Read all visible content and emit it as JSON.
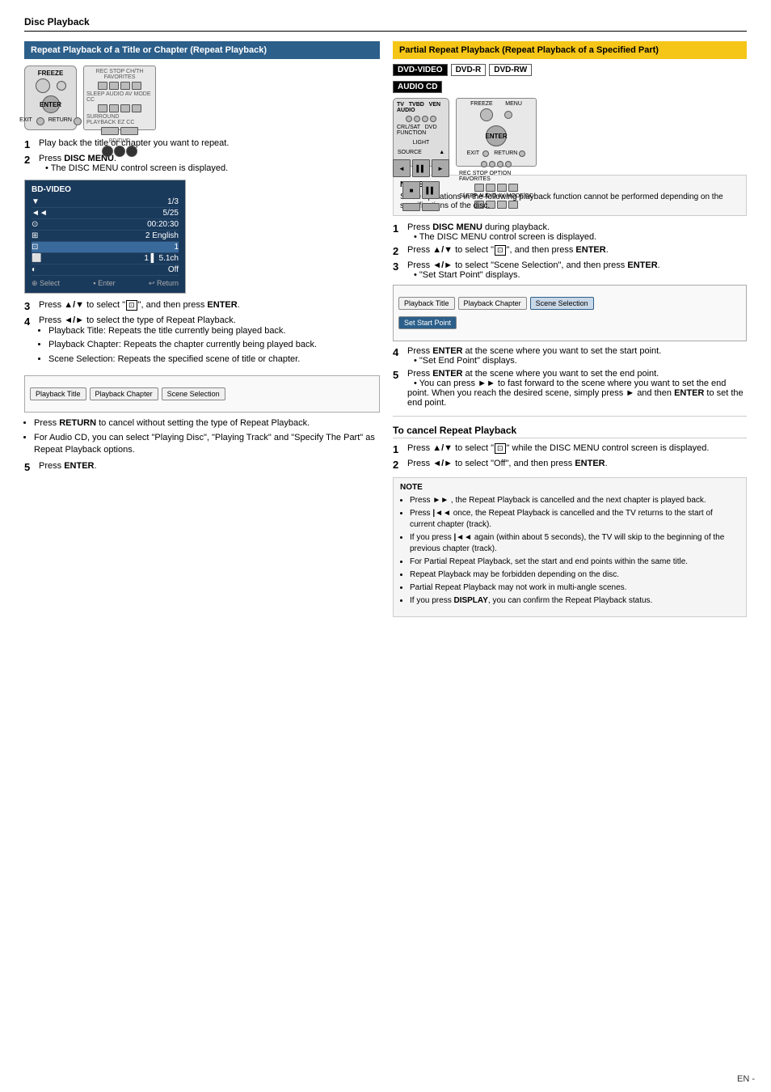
{
  "page": {
    "title": "Disc Playback"
  },
  "left_section": {
    "header": "Repeat Playback of a Title or Chapter (Repeat Playback)",
    "steps": [
      {
        "num": "1",
        "text": "Play back the title or chapter you want to repeat."
      },
      {
        "num": "2",
        "text_prefix": "Press ",
        "bold": "DISC MENU",
        "text_suffix": ".",
        "sub": "• The DISC MENU control screen is displayed."
      },
      {
        "num": "3",
        "text_prefix": "Press ",
        "arrow": "▲/▼",
        "text_mid": " to select “",
        "icon_text": "⊡",
        "text_suffix": "”, and then press ",
        "bold2": "ENTER",
        "end": "."
      },
      {
        "num": "4",
        "text_prefix": "Press ",
        "arrow2": "◄/►",
        "text_mid": " to select the type of Repeat Playback.",
        "bullets": [
          "Playback Title: Repeats the title currently being played back.",
          "Playback Chapter: Repeats the chapter currently being played back.",
          "Scene Selection: Repeats the specified scene of title or chapter."
        ]
      },
      {
        "num": "5",
        "text_prefix": "Press ",
        "bold": "ENTER",
        "end": "."
      }
    ],
    "extra_bullets": [
      "Press RETURN to cancel without setting the type of Repeat Playback.",
      "For Audio CD, you can select \"Playing Disc\", \"Playing Track\" and \"Specify The Part\" as Repeat Playback options."
    ],
    "screen_data": {
      "header": "BD-VIDEO",
      "rows": [
        {
          "label": "▼",
          "value": "1/3"
        },
        {
          "label": "◄◄",
          "value": "5/25"
        },
        {
          "label": "⊙",
          "value": "00:20:30"
        },
        {
          "label": "⊞",
          "value": "2 English"
        },
        {
          "label": "⊡",
          "value": "1"
        },
        {
          "label": "⬜",
          "value": "1  ▐▐  5.1ch"
        },
        {
          "label": "◐",
          "value": "Off"
        }
      ],
      "footer_left": "⊕ Select",
      "footer_mid": "ENTER Enter",
      "footer_right": "RETURN Return"
    },
    "options_bar": [
      {
        "label": "Playback Title",
        "type": "normal"
      },
      {
        "label": "Playback Chapter",
        "type": "normal"
      },
      {
        "label": "Scene Selection",
        "type": "normal"
      }
    ]
  },
  "right_section": {
    "header": "Partial Repeat Playback (Repeat Playback of a Specified Part)",
    "formats": [
      "DVD-VIDEO",
      "DVD-R",
      "DVD-RW",
      "AUDIO CD"
    ],
    "note": {
      "header": "NOTE",
      "text": "Some operations in the following playback function cannot be performed depending on the specifications of the disc."
    },
    "steps": [
      {
        "num": "1",
        "text_prefix": "Press ",
        "bold": "DISC MENU",
        "text_suffix": " during playback.",
        "sub": "• The DISC MENU control screen is displayed."
      },
      {
        "num": "2",
        "text_prefix": "Press ",
        "arrow": "▲/▼",
        "text_mid": " to select “",
        "icon_text": "⊡",
        "text_suffix": "”, and then press ",
        "bold2": "ENTER",
        "end": "."
      },
      {
        "num": "3",
        "text_prefix": "Press ",
        "arrow2": "◄/►",
        "text_mid": " to select “Scene Selection”, and then press ",
        "bold2": "ENTER",
        "end": ".",
        "sub": "• \"Set Start Point\" displays."
      },
      {
        "num": "4",
        "text_prefix": "Press ",
        "bold": "ENTER",
        "text_suffix": " at the scene where you want to set the start point.",
        "sub": "• \"Set End Point\" displays."
      },
      {
        "num": "5",
        "text_prefix": "Press ",
        "bold": "ENTER",
        "text_suffix": " at the scene where you want to set the end point.",
        "sub": "• You can press ►► to fast forward to the scene where you want to set the end point. When you reach the desired scene, simply press ► and then ENTER to set the end point."
      }
    ],
    "options_bar_right": [
      {
        "label": "Playback Title",
        "type": "normal"
      },
      {
        "label": "Playback Chapter",
        "type": "normal"
      },
      {
        "label": "Scene Selection",
        "type": "highlighted"
      },
      {
        "label": "Set Start Point",
        "type": "selected"
      }
    ],
    "cancel_section": {
      "title": "To cancel Repeat Playback",
      "steps": [
        {
          "num": "1",
          "text_prefix": "Press ",
          "arrow": "▲/▼",
          "text_mid": " to select “",
          "icon_text": "⊡",
          "text_suffix": "” while the DISC MENU control screen is displayed."
        },
        {
          "num": "2",
          "text_prefix": "Press ",
          "arrow2": "◄/►",
          "text_mid": " to select “Off”, and then press ",
          "bold2": "ENTER",
          "end": "."
        }
      ]
    },
    "bottom_note": {
      "header": "NOTE",
      "bullets": [
        "Press ►► , the Repeat Playback is cancelled and the next chapter is played back.",
        "Press |◄◄ once, the Repeat Playback is cancelled and the TV returns to the start of current chapter (track).",
        "If you press |◄◄ again (within about 5 seconds), the TV will skip to the beginning of the previous chapter (track).",
        "For Partial Repeat Playback, set the start and end points within the same title.",
        "Repeat Playback may be forbidden depending on the disc.",
        "Partial Repeat Playback may not work in multi-angle scenes.",
        "If you press DISPLAY, you can confirm the Repeat Playback status."
      ]
    }
  },
  "page_number": "EN -"
}
